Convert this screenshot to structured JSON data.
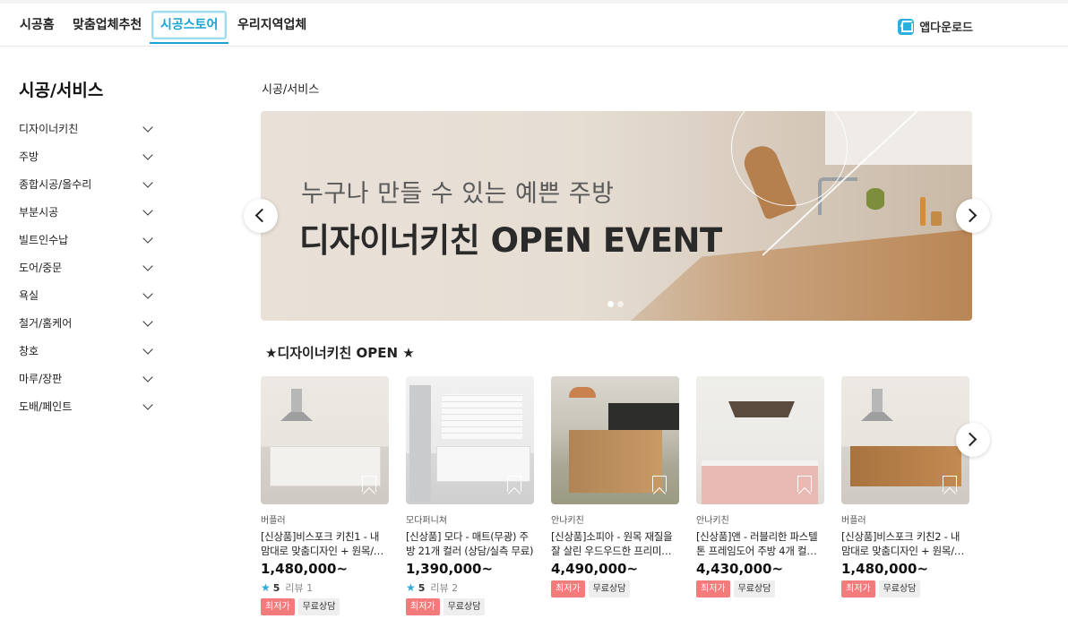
{
  "nav": {
    "tabs": [
      "시공홈",
      "맞춤업체추천",
      "시공스토어",
      "우리지역업체"
    ],
    "active_tab": "시공스토어",
    "app_download": "앱다운로드"
  },
  "sidebar": {
    "title": "시공/서비스",
    "items": [
      "디자이너키친",
      "주방",
      "종합시공/올수리",
      "부분시공",
      "빌트인수납",
      "도어/중문",
      "욕실",
      "철거/홈케어",
      "창호",
      "마루/장판",
      "도배/페인트"
    ]
  },
  "breadcrumb": "시공/서비스",
  "banner": {
    "subtitle": "누구나 만들 수 있는 예쁜 주방",
    "title": "디자이너키친 OPEN EVENT",
    "slide_count": 2,
    "active_slide": 1
  },
  "section": {
    "title": "★디자이너키친 OPEN ★"
  },
  "products": [
    {
      "brand": "버플러",
      "name": "[신상품]비스포크 키친1 - 내 맘대로 맞춤디자인 + 원목/…",
      "price": "1,480,000~",
      "rating": "5",
      "reviews": "리뷰 1",
      "tags": [
        "최저가",
        "무료상담"
      ]
    },
    {
      "brand": "모다퍼니쳐",
      "name": "[신상품] 모다 - 매트(무광) 주방 21개 컬러 (상담/실측 무료)",
      "price": "1,390,000~",
      "rating": "5",
      "reviews": "리뷰 2",
      "tags": [
        "최저가",
        "무료상담"
      ]
    },
    {
      "brand": "안나키친",
      "name": "[신상품]소피아 - 원목 재질을 잘 살린 우드우드한 프리미…",
      "price": "4,490,000~",
      "rating": "",
      "reviews": "",
      "tags": [
        "최저가",
        "무료상담"
      ]
    },
    {
      "brand": "안나키친",
      "name": "[신상품]앤 - 러블리한 파스텔톤 프레임도어 주방 4개 컬…",
      "price": "4,430,000~",
      "rating": "",
      "reviews": "",
      "tags": [
        "최저가",
        "무료상담"
      ]
    },
    {
      "brand": "버플러",
      "name": "[신상품]비스포크 키친2 - 내 맘대로 맞춤디자인 + 원목/…",
      "price": "1,480,000~",
      "rating": "",
      "reviews": "",
      "tags": [
        "최저가",
        "무료상담"
      ]
    }
  ],
  "colors": {
    "accent": "#1aa3d0",
    "tag_low_price": "#f47b7b",
    "star": "#32a9d9"
  }
}
